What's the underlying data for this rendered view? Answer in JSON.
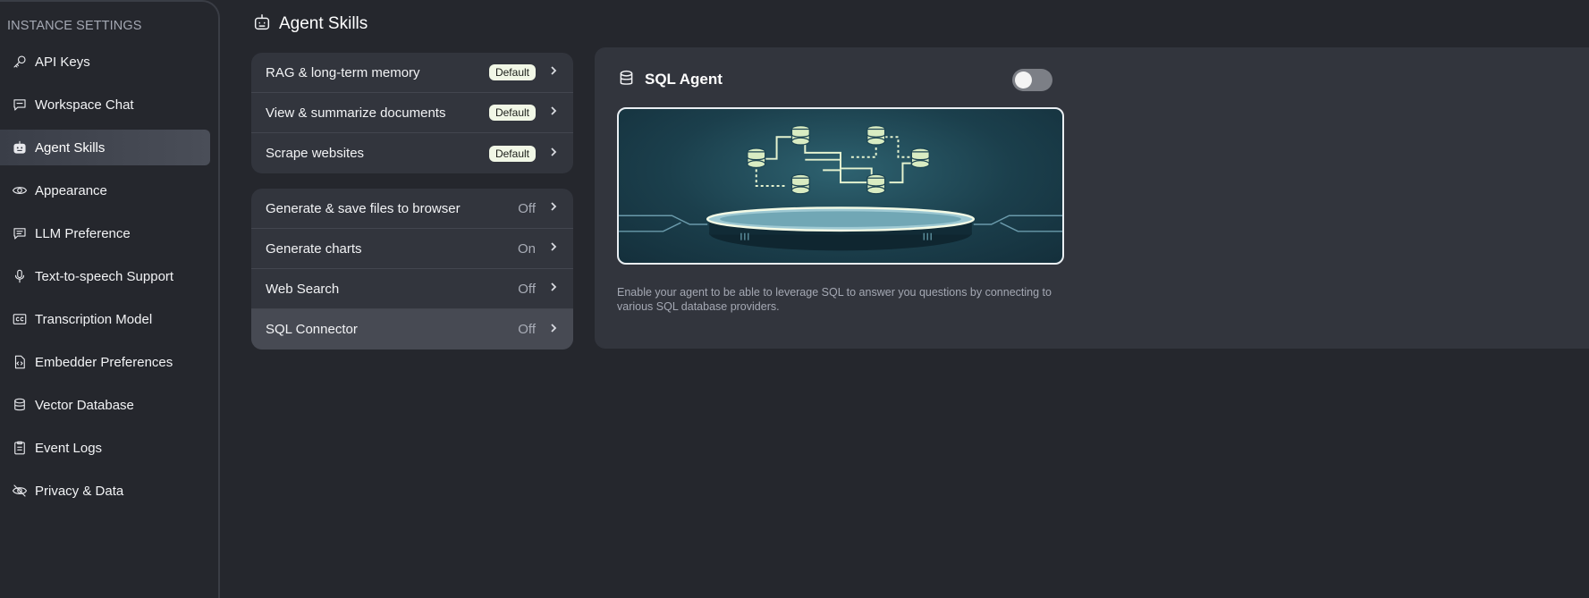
{
  "sidebar": {
    "heading": "INSTANCE SETTINGS",
    "items": [
      {
        "label": "API Keys",
        "icon": "key-icon",
        "active": false
      },
      {
        "label": "Workspace Chat",
        "icon": "chat-icon",
        "active": false
      },
      {
        "label": "Agent Skills",
        "icon": "robot-icon",
        "active": true
      },
      {
        "label": "Appearance",
        "icon": "eye-icon",
        "active": false
      },
      {
        "label": "LLM Preference",
        "icon": "chat-text-icon",
        "active": false
      },
      {
        "label": "Text-to-speech Support",
        "icon": "microphone-icon",
        "active": false
      },
      {
        "label": "Transcription Model",
        "icon": "closed-captions-icon",
        "active": false
      },
      {
        "label": "Embedder Preferences",
        "icon": "file-code-icon",
        "active": false
      },
      {
        "label": "Vector Database",
        "icon": "database-icon",
        "active": false
      },
      {
        "label": "Event Logs",
        "icon": "clipboard-icon",
        "active": false
      },
      {
        "label": "Privacy & Data",
        "icon": "eye-slash-icon",
        "active": false
      }
    ]
  },
  "header": {
    "title": "Agent Skills",
    "icon": "robot-icon"
  },
  "default_skills": [
    {
      "name": "RAG & long-term memory",
      "badge": "Default"
    },
    {
      "name": "View & summarize documents",
      "badge": "Default"
    },
    {
      "name": "Scrape websites",
      "badge": "Default"
    }
  ],
  "configurable_skills": [
    {
      "name": "Generate & save files to browser",
      "status": "Off"
    },
    {
      "name": "Generate charts",
      "status": "On"
    },
    {
      "name": "Web Search",
      "status": "Off"
    },
    {
      "name": "SQL Connector",
      "status": "Off",
      "selected": true
    }
  ],
  "detail": {
    "icon": "database-icon",
    "title": "SQL Agent",
    "enabled": false,
    "description": "Enable your agent to be able to leverage SQL to answer you questions by connecting to various SQL database providers."
  },
  "colors": {
    "background": "#25272d",
    "panel": "#32353d",
    "active_nav": "#454952",
    "badge_bg": "#f1f7e6",
    "toggle_off": "#7c7f86"
  }
}
